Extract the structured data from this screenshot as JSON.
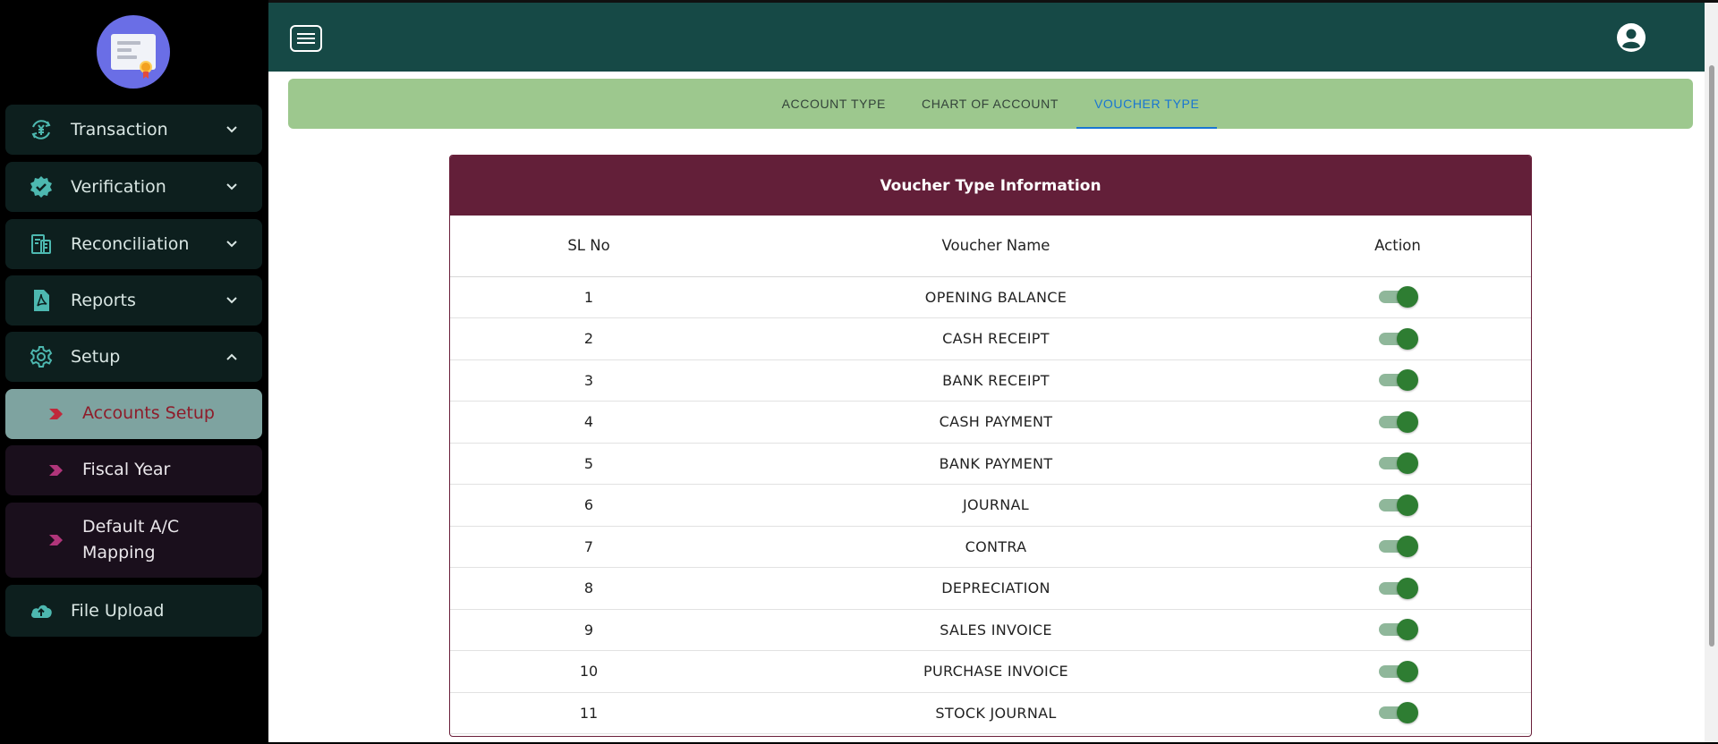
{
  "sidebar": {
    "menu": [
      {
        "label": "Transaction",
        "icon": "currency-exchange-icon"
      },
      {
        "label": "Verification",
        "icon": "verified-badge-icon"
      },
      {
        "label": "Reconciliation",
        "icon": "reconciliation-icon"
      },
      {
        "label": "Reports",
        "icon": "pdf-report-icon"
      },
      {
        "label": "Setup",
        "icon": "gear-icon"
      }
    ],
    "setup_sub": [
      {
        "label": "Accounts Setup",
        "active": true
      },
      {
        "label": "Fiscal Year",
        "active": false
      },
      {
        "label_line1": "Default A/C",
        "label_line2": "Mapping",
        "active": false
      }
    ],
    "file_upload": {
      "label": "File Upload",
      "icon": "cloud-upload-icon"
    }
  },
  "tabs": [
    {
      "label": "ACCOUNT TYPE",
      "active": false
    },
    {
      "label": "CHART OF ACCOUNT",
      "active": false
    },
    {
      "label": "VOUCHER TYPE",
      "active": true
    }
  ],
  "table": {
    "title": "Voucher Type Information",
    "headers": {
      "sl": "SL No",
      "name": "Voucher Name",
      "action": "Action"
    },
    "rows": [
      {
        "sl": "1",
        "name": "OPENING BALANCE",
        "enabled": true
      },
      {
        "sl": "2",
        "name": "CASH RECEIPT",
        "enabled": true
      },
      {
        "sl": "3",
        "name": "BANK RECEIPT",
        "enabled": true
      },
      {
        "sl": "4",
        "name": "CASH PAYMENT",
        "enabled": true
      },
      {
        "sl": "5",
        "name": "BANK PAYMENT",
        "enabled": true
      },
      {
        "sl": "6",
        "name": "JOURNAL",
        "enabled": true
      },
      {
        "sl": "7",
        "name": "CONTRA",
        "enabled": true
      },
      {
        "sl": "8",
        "name": "DEPRECIATION",
        "enabled": true
      },
      {
        "sl": "9",
        "name": "SALES INVOICE",
        "enabled": true
      },
      {
        "sl": "10",
        "name": "PURCHASE INVOICE",
        "enabled": true
      },
      {
        "sl": "11",
        "name": "STOCK JOURNAL",
        "enabled": true
      }
    ]
  },
  "colors": {
    "topbar": "#164946",
    "tab_bar": "#9dc88e",
    "card_header": "#631f39",
    "active_tab": "#1976d2",
    "toggle_on": "#2e7d32"
  }
}
